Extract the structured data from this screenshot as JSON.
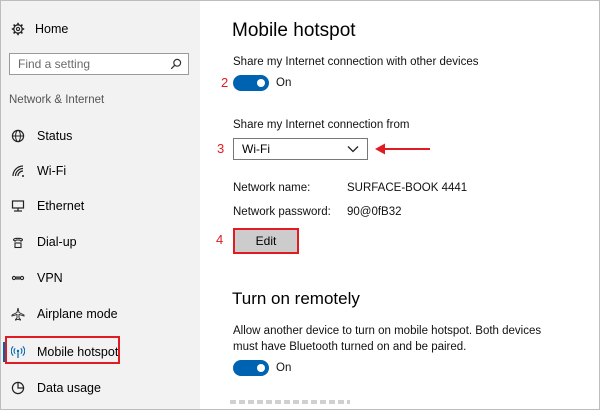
{
  "sidebar": {
    "home_label": "Home",
    "search_placeholder": "Find a setting",
    "section_label": "Network & Internet",
    "items": [
      {
        "label": "Status",
        "icon": "globe-icon"
      },
      {
        "label": "Wi-Fi",
        "icon": "wifi-icon"
      },
      {
        "label": "Ethernet",
        "icon": "ethernet-icon"
      },
      {
        "label": "Dial-up",
        "icon": "phone-icon"
      },
      {
        "label": "VPN",
        "icon": "vpn-icon"
      },
      {
        "label": "Airplane mode",
        "icon": "airplane-icon"
      },
      {
        "label": "Mobile hotspot",
        "icon": "hotspot-icon",
        "selected": true
      },
      {
        "label": "Data usage",
        "icon": "data-usage-icon"
      }
    ]
  },
  "main": {
    "title": "Mobile hotspot",
    "share_label": "Share my Internet connection with other devices",
    "share_toggle_state": "On",
    "share_from_label": "Share my Internet connection from",
    "share_from_value": "Wi-Fi",
    "network_name_label": "Network name:",
    "network_name_value": "SURFACE-BOOK 4441",
    "network_password_label": "Network password:",
    "network_password_value": "90@0fB32",
    "edit_label": "Edit",
    "remote_title": "Turn on remotely",
    "remote_desc_line1": "Allow another device to turn on mobile hotspot. Both devices",
    "remote_desc_line2": "must have Bluetooth turned on and be paired.",
    "remote_toggle_state": "On"
  },
  "annotations": {
    "step2": "2",
    "step3": "3",
    "step4": "4"
  },
  "colors": {
    "accent": "#0063b1",
    "highlight": "#e11b22",
    "sidebar_bg": "#f2f2f2"
  }
}
